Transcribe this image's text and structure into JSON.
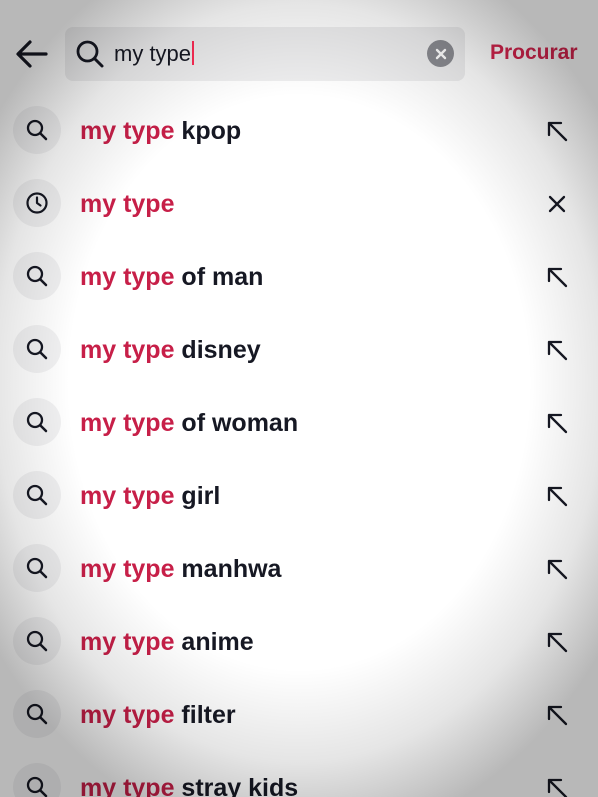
{
  "search": {
    "value": "my type",
    "action_label": "Procurar"
  },
  "icons": {
    "back": "arrow-left-icon",
    "search": "search-icon",
    "clear": "clear-x-circle-icon",
    "history": "clock-icon",
    "fill": "arrow-up-left-icon",
    "remove": "close-icon"
  },
  "colors": {
    "accent": "#c71f48",
    "action": "#d4244d",
    "text": "#161823",
    "field_bg": "#eeeeef"
  },
  "suggestions": [
    {
      "highlight": "my type",
      "rest": " kpop",
      "kind": "search"
    },
    {
      "highlight": "my type",
      "rest": "",
      "kind": "history"
    },
    {
      "highlight": "my type",
      "rest": " of man",
      "kind": "search"
    },
    {
      "highlight": "my type",
      "rest": " disney",
      "kind": "search"
    },
    {
      "highlight": "my type",
      "rest": " of woman",
      "kind": "search"
    },
    {
      "highlight": "my type",
      "rest": " girl",
      "kind": "search"
    },
    {
      "highlight": "my type",
      "rest": " manhwa",
      "kind": "search"
    },
    {
      "highlight": "my type",
      "rest": " anime",
      "kind": "search"
    },
    {
      "highlight": "my type",
      "rest": " filter",
      "kind": "search"
    },
    {
      "highlight": "my type",
      "rest": " stray kids",
      "kind": "search"
    }
  ]
}
